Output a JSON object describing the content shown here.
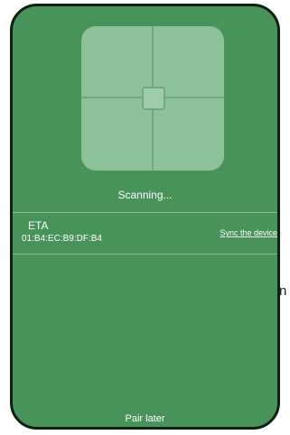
{
  "background_text": "n",
  "scanner": {
    "status_label": "Scanning..."
  },
  "devices": [
    {
      "name": "ETA",
      "mac": "01:B4:EC:B9:DF:B4",
      "action_label": "Sync the device"
    }
  ],
  "footer": {
    "pair_later_label": "Pair later"
  },
  "colors": {
    "panel_bg": "#47935a",
    "scan_box": "#8cc19a",
    "panel_border": "#0f1f14",
    "text": "#ffffff"
  }
}
